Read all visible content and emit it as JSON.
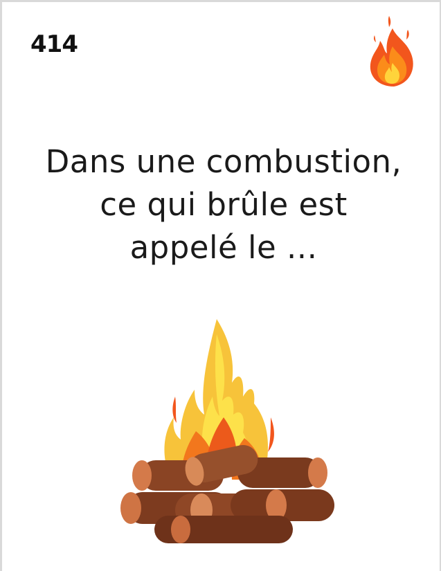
{
  "card": {
    "number": "414",
    "question_lines": [
      "Dans une combustion,",
      "ce qui brûle est",
      "appelé le ..."
    ]
  },
  "icons": {
    "corner": "fire-icon",
    "illustration": "campfire-illustration"
  },
  "colors": {
    "flame_outer": "#f2561d",
    "flame_mid": "#fb8c1a",
    "flame_inner": "#ffd43b",
    "log_brown": "#8a4424",
    "log_end": "#d47a4a",
    "border": "#d9d9d9"
  }
}
